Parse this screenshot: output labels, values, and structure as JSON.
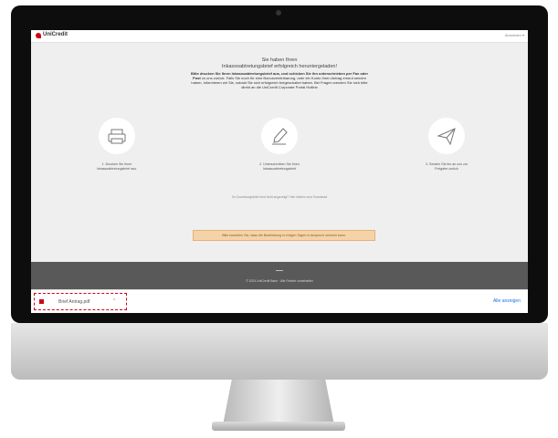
{
  "header": {
    "logo_text": "UniCredit",
    "user_menu": "Abmelden ▾"
  },
  "main": {
    "headline_line1": "Sie haben Ihren",
    "headline_line2": "Inkassoabtretungsbrief erfolgreich heruntergeladen!",
    "intro_bold": "Bitte drucken Sie Ihren Inkassoabtretungsbrief aus, und schicken Sie ihn unterschrieben per Fax oder Post",
    "intro_rest": "zu uns zurück. Falls Sie noch für eine Bonusvereinbarung, oder ein Konto Ihren Antrag erneut senden haben, informieren wir Sie, sobald Sie sich erfolgreich freigeschaltet haben. Bei Fragen wenden Sie sich bitte direkt an die UniCredit Corporate Portal Hotline",
    "steps": [
      {
        "icon": "printer-icon",
        "label": "1. Drucken Sie Ihren Inkassoabtretungsbrief aus."
      },
      {
        "icon": "pen-icon",
        "label": "2. Unterschreiben Sie Ihren Inkassoabtretungsbrief"
      },
      {
        "icon": "send-icon",
        "label": "3. Senden Sie ihn an uns zur Freigabe zurück"
      }
    ],
    "small_link": "Ihr Zuordnungsbrief wird nicht angezeigt? Hier klicken zum Download",
    "notice": "Bitte beachten Sie, dass die Bearbeitung in einigen Tagen in Anspruch nehmen kann."
  },
  "footer": {
    "legal": "© 2024 UniCredit Bank · Alle Rechte vorbehalten"
  },
  "download_bar": {
    "file_name": "Brief Antrag.pdf",
    "show_all": "Alle anzeigen"
  },
  "colors": {
    "brand_red": "#d0021b",
    "notice_bg": "#f5d3a6",
    "footer_bg": "#595959",
    "link_blue": "#1a73e8"
  }
}
